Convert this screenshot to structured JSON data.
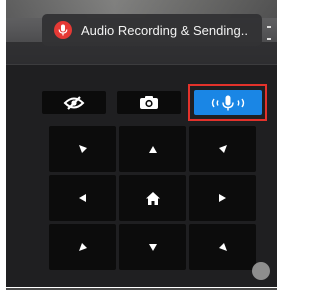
{
  "status_banner": {
    "text": "Audio Recording & Sending..",
    "icon": "microphone-recording-icon",
    "icon_color": "#e53935"
  },
  "toolbar": {
    "buttons": [
      {
        "name": "hide-video-button",
        "icon": "eye-slash-icon"
      },
      {
        "name": "snapshot-button",
        "icon": "camera-icon"
      },
      {
        "name": "microphone-button",
        "icon": "microphone-icon",
        "active": true,
        "active_color": "#1a86e5",
        "highlight_color": "#e3322b"
      }
    ]
  },
  "ptz_pad": {
    "cells": [
      {
        "name": "ptz-up-left-button",
        "icon": "arrow-up-left-icon"
      },
      {
        "name": "ptz-up-button",
        "icon": "arrow-up-icon"
      },
      {
        "name": "ptz-up-right-button",
        "icon": "arrow-up-right-icon"
      },
      {
        "name": "ptz-left-button",
        "icon": "arrow-left-icon"
      },
      {
        "name": "ptz-home-button",
        "icon": "home-icon"
      },
      {
        "name": "ptz-right-button",
        "icon": "arrow-right-icon"
      },
      {
        "name": "ptz-down-left-button",
        "icon": "arrow-down-left-icon"
      },
      {
        "name": "ptz-down-button",
        "icon": "arrow-down-icon"
      },
      {
        "name": "ptz-down-right-button",
        "icon": "arrow-down-right-icon"
      }
    ]
  }
}
